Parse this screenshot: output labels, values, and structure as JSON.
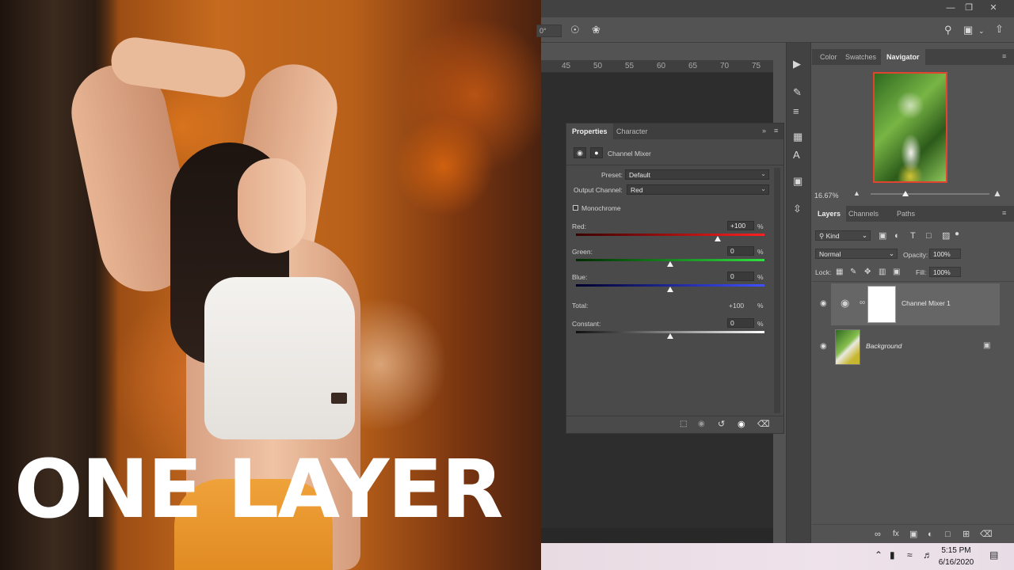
{
  "thumbnail": {
    "overlay_text": "ONE LAYER"
  },
  "options_bar": {
    "angle_value": "0°"
  },
  "ruler": {
    "ticks": [
      "45",
      "50",
      "55",
      "60",
      "65",
      "70",
      "75"
    ]
  },
  "properties_panel": {
    "tabs": [
      "Properties",
      "Character"
    ],
    "active_tab": "Properties",
    "adjustment_name": "Channel Mixer",
    "preset_label": "Preset:",
    "preset_value": "Default",
    "output_channel_label": "Output Channel:",
    "output_channel_value": "Red",
    "monochrome_label": "Monochrome",
    "monochrome_checked": false,
    "sliders": [
      {
        "label": "Red:",
        "value": "+100",
        "level": 100,
        "colors": [
          "#3a0000",
          "#ff2020"
        ]
      },
      {
        "label": "Green:",
        "value": "0",
        "level": 0,
        "colors": [
          "#002a00",
          "#30e040"
        ]
      },
      {
        "label": "Blue:",
        "value": "0",
        "level": 0,
        "colors": [
          "#00002a",
          "#4050ff"
        ]
      }
    ],
    "total_label": "Total:",
    "total_value": "+100",
    "constant_label": "Constant:",
    "constant_value": "0",
    "constant_level": 0,
    "percent_sign": "%"
  },
  "navigator_panel": {
    "tabs": [
      "Color",
      "Swatches",
      "Navigator"
    ],
    "active_tab": "Navigator",
    "zoom": "16.67%"
  },
  "layers_panel": {
    "tabs": [
      "Layers",
      "Channels",
      "Paths"
    ],
    "active_tab": "Layers",
    "filter_kind": "Kind",
    "blend_mode": "Normal",
    "opacity_label": "Opacity:",
    "opacity_value": "100%",
    "lock_label": "Lock:",
    "fill_label": "Fill:",
    "fill_value": "100%",
    "layers": [
      {
        "name": "Channel Mixer 1",
        "visible": true,
        "selected": true
      },
      {
        "name": "Background",
        "visible": true,
        "selected": false,
        "locked": true
      }
    ]
  },
  "taskbar": {
    "time": "5:15 PM",
    "date": "6/16/2020"
  },
  "colors": {
    "panel_bg": "#535353",
    "panel_dark": "#424242",
    "canvas_bg": "#282828",
    "navigator_frame": "#e2452f",
    "text_overlay": "#ffffff"
  }
}
